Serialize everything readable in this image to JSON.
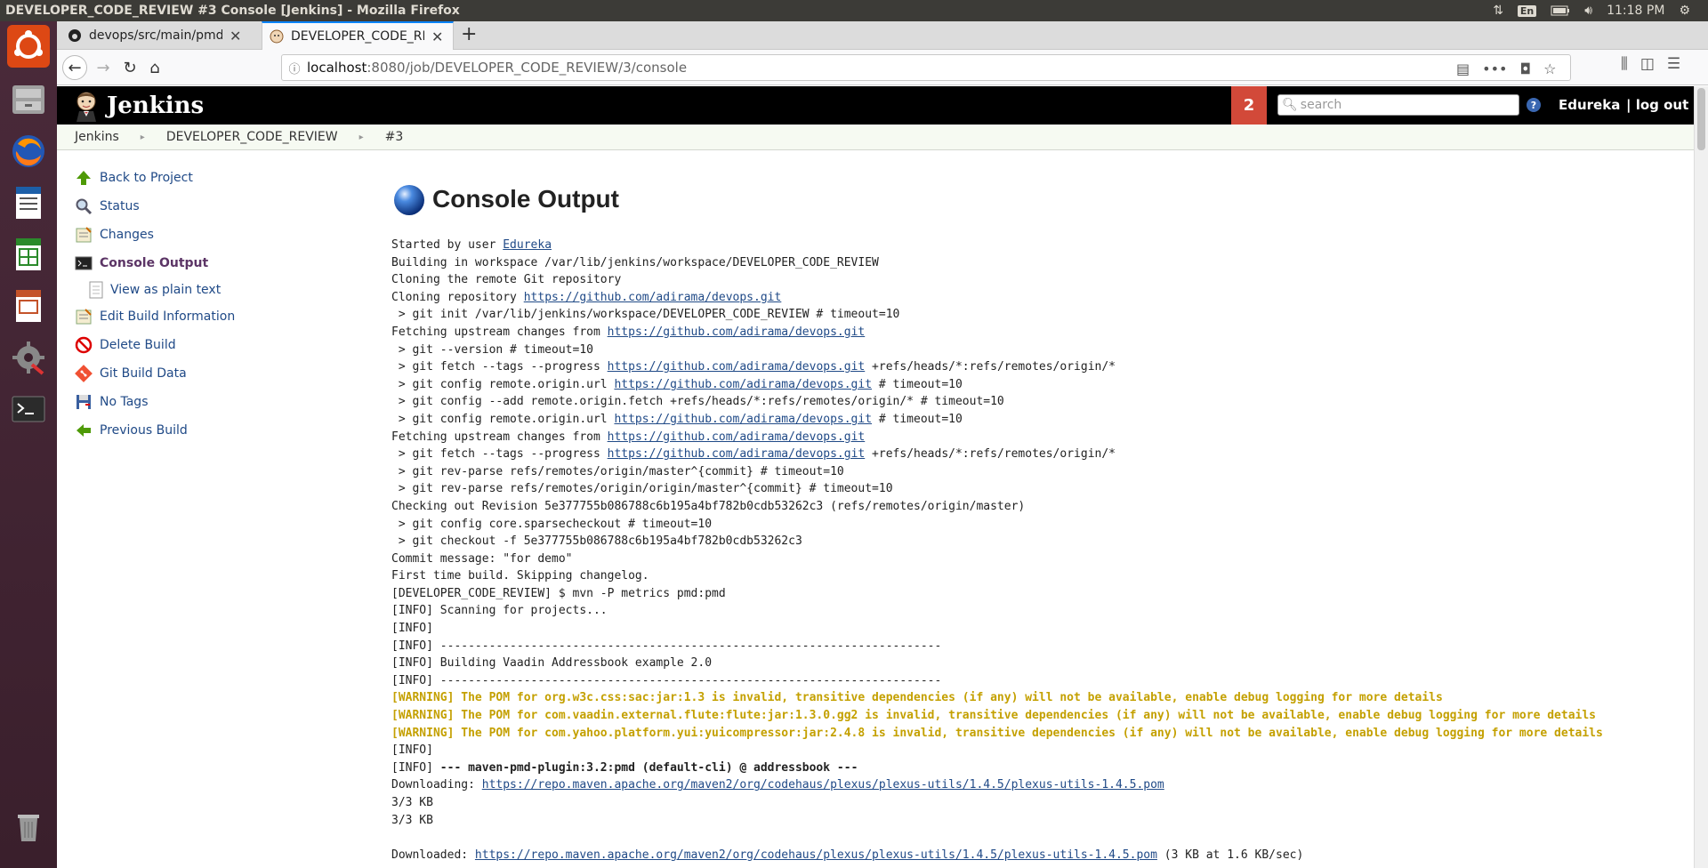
{
  "os": {
    "window_title": "DEVELOPER_CODE_REVIEW #3 Console [Jenkins] - Mozilla Firefox",
    "keyboard_layout": "En",
    "clock": "11:18 PM"
  },
  "browser": {
    "tabs": [
      {
        "label": "devops/src/main/pmd at"
      },
      {
        "label": "DEVELOPER_CODE_REVIEW"
      }
    ],
    "url_host": "localhost",
    "url_rest": ":8080/job/DEVELOPER_CODE_REVIEW/3/console"
  },
  "jenkins": {
    "brand": "Jenkins",
    "notification_count": "2",
    "search_placeholder": "search",
    "user": "Edureka",
    "logout": "| log out"
  },
  "breadcrumb": [
    "Jenkins",
    "DEVELOPER_CODE_REVIEW",
    "#3"
  ],
  "sidebar": {
    "items": [
      {
        "label": "Back to Project"
      },
      {
        "label": "Status"
      },
      {
        "label": "Changes"
      },
      {
        "label": "Console Output"
      },
      {
        "label": "View as plain text"
      },
      {
        "label": "Edit Build Information"
      },
      {
        "label": "Delete Build"
      },
      {
        "label": "Git Build Data"
      },
      {
        "label": "No Tags"
      },
      {
        "label": "Previous Build"
      }
    ]
  },
  "main": {
    "title": "Console Output"
  },
  "console": {
    "lines": [
      [
        {
          "t": "Started by user "
        },
        {
          "t": "Edureka",
          "link": true
        }
      ],
      [
        {
          "t": "Building in workspace /var/lib/jenkins/workspace/DEVELOPER_CODE_REVIEW"
        }
      ],
      [
        {
          "t": "Cloning the remote Git repository"
        }
      ],
      [
        {
          "t": "Cloning repository "
        },
        {
          "t": "https://github.com/adirama/devops.git",
          "link": true
        }
      ],
      [
        {
          "t": " > git init /var/lib/jenkins/workspace/DEVELOPER_CODE_REVIEW # timeout=10"
        }
      ],
      [
        {
          "t": "Fetching upstream changes from "
        },
        {
          "t": "https://github.com/adirama/devops.git",
          "link": true
        }
      ],
      [
        {
          "t": " > git --version # timeout=10"
        }
      ],
      [
        {
          "t": " > git fetch --tags --progress "
        },
        {
          "t": "https://github.com/adirama/devops.git",
          "link": true
        },
        {
          "t": " +refs/heads/*:refs/remotes/origin/*"
        }
      ],
      [
        {
          "t": " > git config remote.origin.url "
        },
        {
          "t": "https://github.com/adirama/devops.git",
          "link": true
        },
        {
          "t": " # timeout=10"
        }
      ],
      [
        {
          "t": " > git config --add remote.origin.fetch +refs/heads/*:refs/remotes/origin/* # timeout=10"
        }
      ],
      [
        {
          "t": " > git config remote.origin.url "
        },
        {
          "t": "https://github.com/adirama/devops.git",
          "link": true
        },
        {
          "t": " # timeout=10"
        }
      ],
      [
        {
          "t": "Fetching upstream changes from "
        },
        {
          "t": "https://github.com/adirama/devops.git",
          "link": true
        }
      ],
      [
        {
          "t": " > git fetch --tags --progress "
        },
        {
          "t": "https://github.com/adirama/devops.git",
          "link": true
        },
        {
          "t": " +refs/heads/*:refs/remotes/origin/*"
        }
      ],
      [
        {
          "t": " > git rev-parse refs/remotes/origin/master^{commit} # timeout=10"
        }
      ],
      [
        {
          "t": " > git rev-parse refs/remotes/origin/origin/master^{commit} # timeout=10"
        }
      ],
      [
        {
          "t": "Checking out Revision 5e377755b086788c6b195a4bf782b0cdb53262c3 (refs/remotes/origin/master)"
        }
      ],
      [
        {
          "t": " > git config core.sparsecheckout # timeout=10"
        }
      ],
      [
        {
          "t": " > git checkout -f 5e377755b086788c6b195a4bf782b0cdb53262c3"
        }
      ],
      [
        {
          "t": "Commit message: \"for demo\""
        }
      ],
      [
        {
          "t": "First time build. Skipping changelog."
        }
      ],
      [
        {
          "t": "[DEVELOPER_CODE_REVIEW] $ mvn -P metrics pmd:pmd"
        }
      ],
      [
        {
          "t": "[INFO] Scanning for projects..."
        }
      ],
      [
        {
          "t": "[INFO]"
        }
      ],
      [
        {
          "t": "[INFO] ------------------------------------------------------------------------"
        }
      ],
      [
        {
          "t": "[INFO] Building Vaadin Addressbook example 2.0"
        }
      ],
      [
        {
          "t": "[INFO] ------------------------------------------------------------------------"
        }
      ],
      [
        {
          "t": "[WARNING] The POM for org.w3c.css:sac:jar:1.3 is invalid, transitive dependencies (if any) will not be available, enable debug logging for more details",
          "warn": true
        }
      ],
      [
        {
          "t": "[WARNING] The POM for com.vaadin.external.flute:flute:jar:1.3.0.gg2 is invalid, transitive dependencies (if any) will not be available, enable debug logging for more details",
          "warn": true
        }
      ],
      [
        {
          "t": "[WARNING] The POM for com.yahoo.platform.yui:yuicompressor:jar:2.4.8 is invalid, transitive dependencies (if any) will not be available, enable debug logging for more details",
          "warn": true
        }
      ],
      [
        {
          "t": "[INFO]"
        }
      ],
      [
        {
          "t": "[INFO] "
        },
        {
          "t": "--- maven-pmd-plugin:3.2:pmd (default-cli) @ addressbook ---",
          "bold": true
        }
      ],
      [
        {
          "t": "Downloading: "
        },
        {
          "t": "https://repo.maven.apache.org/maven2/org/codehaus/plexus/plexus-utils/1.4.5/plexus-utils-1.4.5.pom",
          "link": true
        }
      ],
      [
        {
          "t": "3/3 KB"
        }
      ],
      [
        {
          "t": "3/3 KB"
        }
      ],
      [
        {
          "t": ""
        }
      ],
      [
        {
          "t": "Downloaded: "
        },
        {
          "t": "https://repo.maven.apache.org/maven2/org/codehaus/plexus/plexus-utils/1.4.5/plexus-utils-1.4.5.pom",
          "link": true
        },
        {
          "t": " (3 KB at 1.6 KB/sec)"
        }
      ]
    ]
  }
}
